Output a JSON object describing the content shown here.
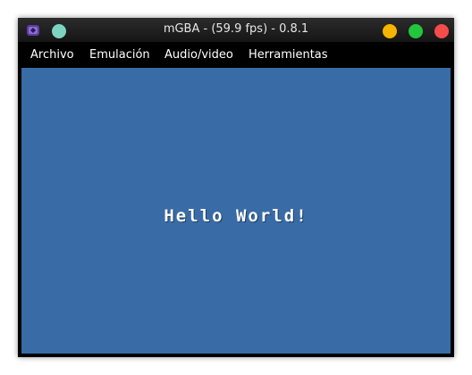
{
  "window": {
    "title": "mGBA - (59.9 fps) - 0.8.1"
  },
  "menubar": {
    "items": [
      {
        "label": "Archivo"
      },
      {
        "label": "Emulación"
      },
      {
        "label": "Audio/video"
      },
      {
        "label": "Herramientas"
      }
    ]
  },
  "screen": {
    "text": "Hello World!",
    "background": "#396ca6"
  },
  "icons": {
    "app": "mgba-app-icon",
    "sticky": "sticky-button-icon",
    "minimize": "minimize-icon",
    "maximize": "maximize-icon",
    "close": "close-icon"
  },
  "colors": {
    "minimize": "#f5b400",
    "maximize": "#22c73b",
    "close": "#f44b4b",
    "sticky": "#7dd3c0"
  }
}
